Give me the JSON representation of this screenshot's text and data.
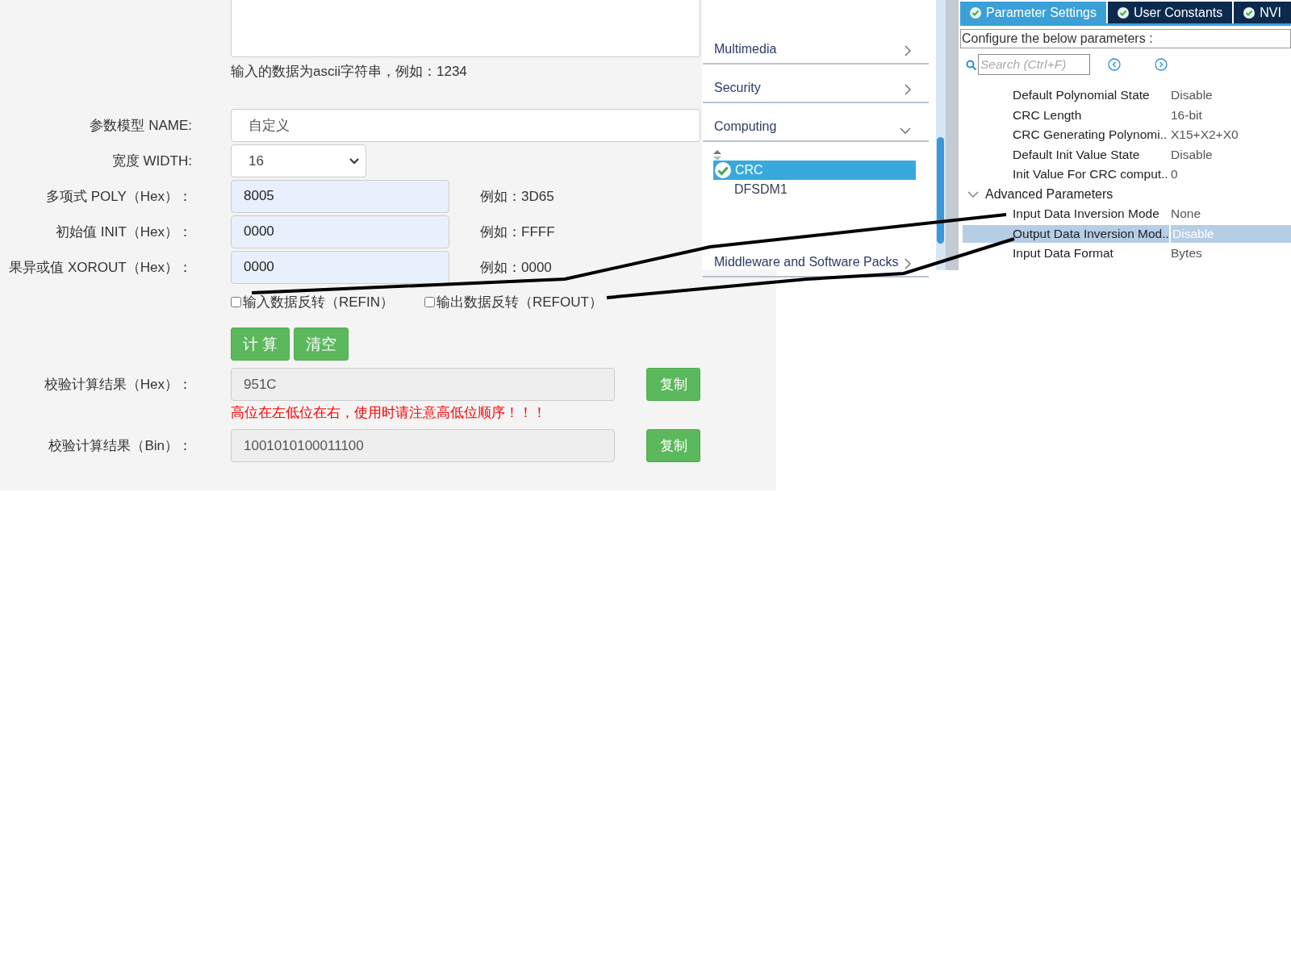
{
  "form": {
    "input_hint": "输入的数据为ascii字符串，例如：1234",
    "fields": [
      {
        "kind": "text",
        "label": "参数模型 NAME:",
        "value": "自定义"
      },
      {
        "kind": "select",
        "label": "宽度 WIDTH:",
        "value": "16"
      },
      {
        "kind": "hex",
        "label": "多项式 POLY（Hex）：",
        "value": "8005",
        "example": "例如：3D65"
      },
      {
        "kind": "hex",
        "label": "初始值 INIT（Hex）：",
        "value": "0000",
        "example": "例如：FFFF"
      },
      {
        "kind": "hex",
        "label": "果异或值 XOROUT（Hex）：",
        "value": "0000",
        "example": "例如：0000"
      }
    ],
    "options": [
      {
        "label": "输入数据反转（REFIN）",
        "checked": false
      },
      {
        "label": "输出数据反转（REFOUT）",
        "checked": false
      }
    ],
    "actions": [
      "计 算",
      "清空"
    ],
    "results": [
      {
        "label": "校验计算结果（Hex）：",
        "value": "951C",
        "copy": "复制",
        "note": "高位在左低位在右，使用时请注意高低位顺序！！！"
      },
      {
        "label": "校验计算结果（Bin）：",
        "value": "1001010100011100",
        "copy": "复制"
      }
    ]
  },
  "categories": [
    {
      "label": "Multimedia",
      "expanded": false
    },
    {
      "label": "Security",
      "expanded": false
    },
    {
      "label": "Computing",
      "expanded": true,
      "children": [
        {
          "label": "CRC",
          "selected": true,
          "enabled": true
        },
        {
          "label": "DFSDM1",
          "selected": false,
          "enabled": false
        }
      ]
    },
    {
      "label": "Middleware and Software Packs",
      "expanded": false
    }
  ],
  "config": {
    "tabs": [
      {
        "label": "Parameter Settings",
        "selected": true
      },
      {
        "label": "User Constants",
        "selected": false
      },
      {
        "label": "NVI",
        "selected": false
      }
    ],
    "description": "Configure the below parameters :",
    "search": {
      "placeholder": "Search (Ctrl+F)"
    },
    "parameters": [
      {
        "label": "Default Polynomial State",
        "value": "Disable",
        "selected": false
      },
      {
        "label": "CRC Length",
        "value": "16-bit",
        "selected": false
      },
      {
        "label": "CRC Generating Polynomi..",
        "value": "X15+X2+X0",
        "selected": false
      },
      {
        "label": "Default Init Value State",
        "value": "Disable",
        "selected": false
      },
      {
        "label": "Init Value For CRC comput..",
        "value": "0",
        "selected": false
      },
      {
        "label": "Advanced Parameters",
        "expanded": true,
        "children": [
          {
            "label": "Input Data Inversion Mode",
            "value": "None",
            "selected": false
          },
          {
            "label": "Output Data Inversion Mod..",
            "value": "Disable",
            "selected": true
          },
          {
            "label": "Input Data Format",
            "value": "Bytes",
            "selected": false
          }
        ]
      }
    ]
  }
}
